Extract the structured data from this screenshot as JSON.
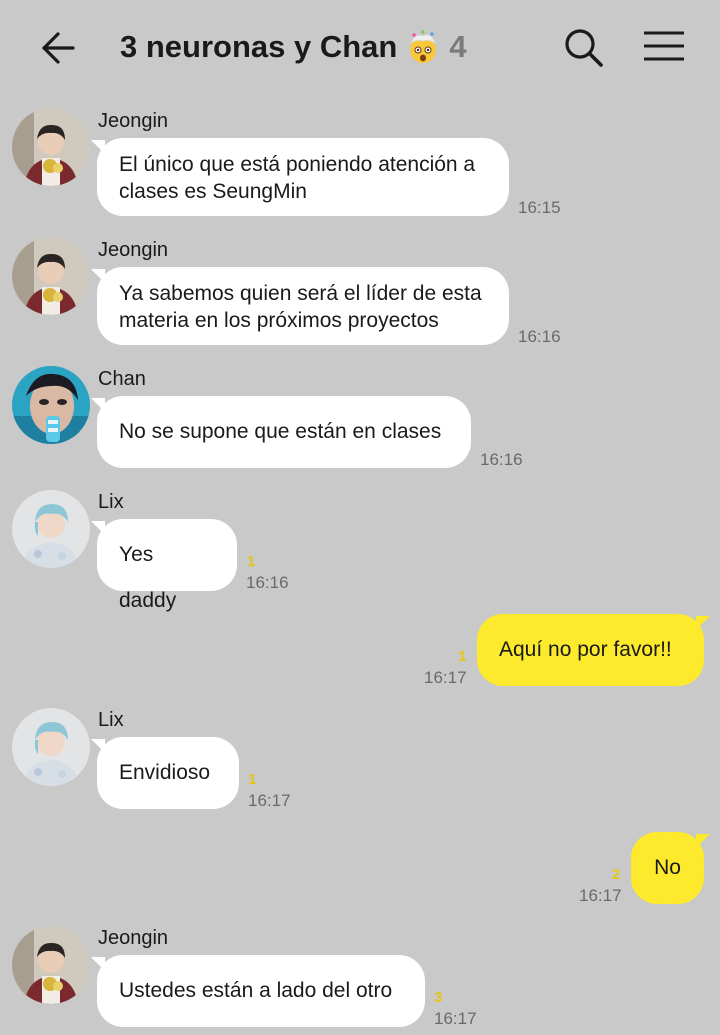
{
  "header": {
    "title": "3 neuronas y Chan",
    "member_count": "4",
    "emoji": "exploding-head-emoji"
  },
  "icons": {
    "back": "back-arrow-icon",
    "search": "search-icon",
    "menu": "hamburger-menu-icon"
  },
  "colors": {
    "background": "#c9c9c9",
    "incoming_bubble": "#ffffff",
    "outgoing_bubble": "#fdea2c",
    "unread_count": "#e3c515"
  },
  "messages": [
    {
      "sender": "Jeongin",
      "text_lines": [
        "El único que está poniendo atención a",
        "clases es SeungMin"
      ],
      "time": "16:15",
      "unread": ""
    },
    {
      "sender": "Jeongin",
      "text_lines": [
        "Ya sabemos quien será el líder de esta",
        "materia en los próximos proyectos"
      ],
      "time": "16:16",
      "unread": ""
    },
    {
      "sender": "Chan",
      "text_lines": [
        "No se supone que están en clases"
      ],
      "time": "16:16",
      "unread": ""
    },
    {
      "sender": "Lix",
      "text_lines": [
        "Yes daddy"
      ],
      "time": "16:16",
      "unread": "1"
    },
    {
      "sender": "",
      "text_lines": [
        "Aquí no por favor!!"
      ],
      "time": "16:17",
      "unread": "1"
    },
    {
      "sender": "Lix",
      "text_lines": [
        "Envidioso"
      ],
      "time": "16:17",
      "unread": "1"
    },
    {
      "sender": "",
      "text_lines": [
        "No"
      ],
      "time": "16:17",
      "unread": "2"
    },
    {
      "sender": "Jeongin",
      "text_lines": [
        "Ustedes están a lado del otro"
      ],
      "time": "16:17",
      "unread": "3"
    }
  ]
}
